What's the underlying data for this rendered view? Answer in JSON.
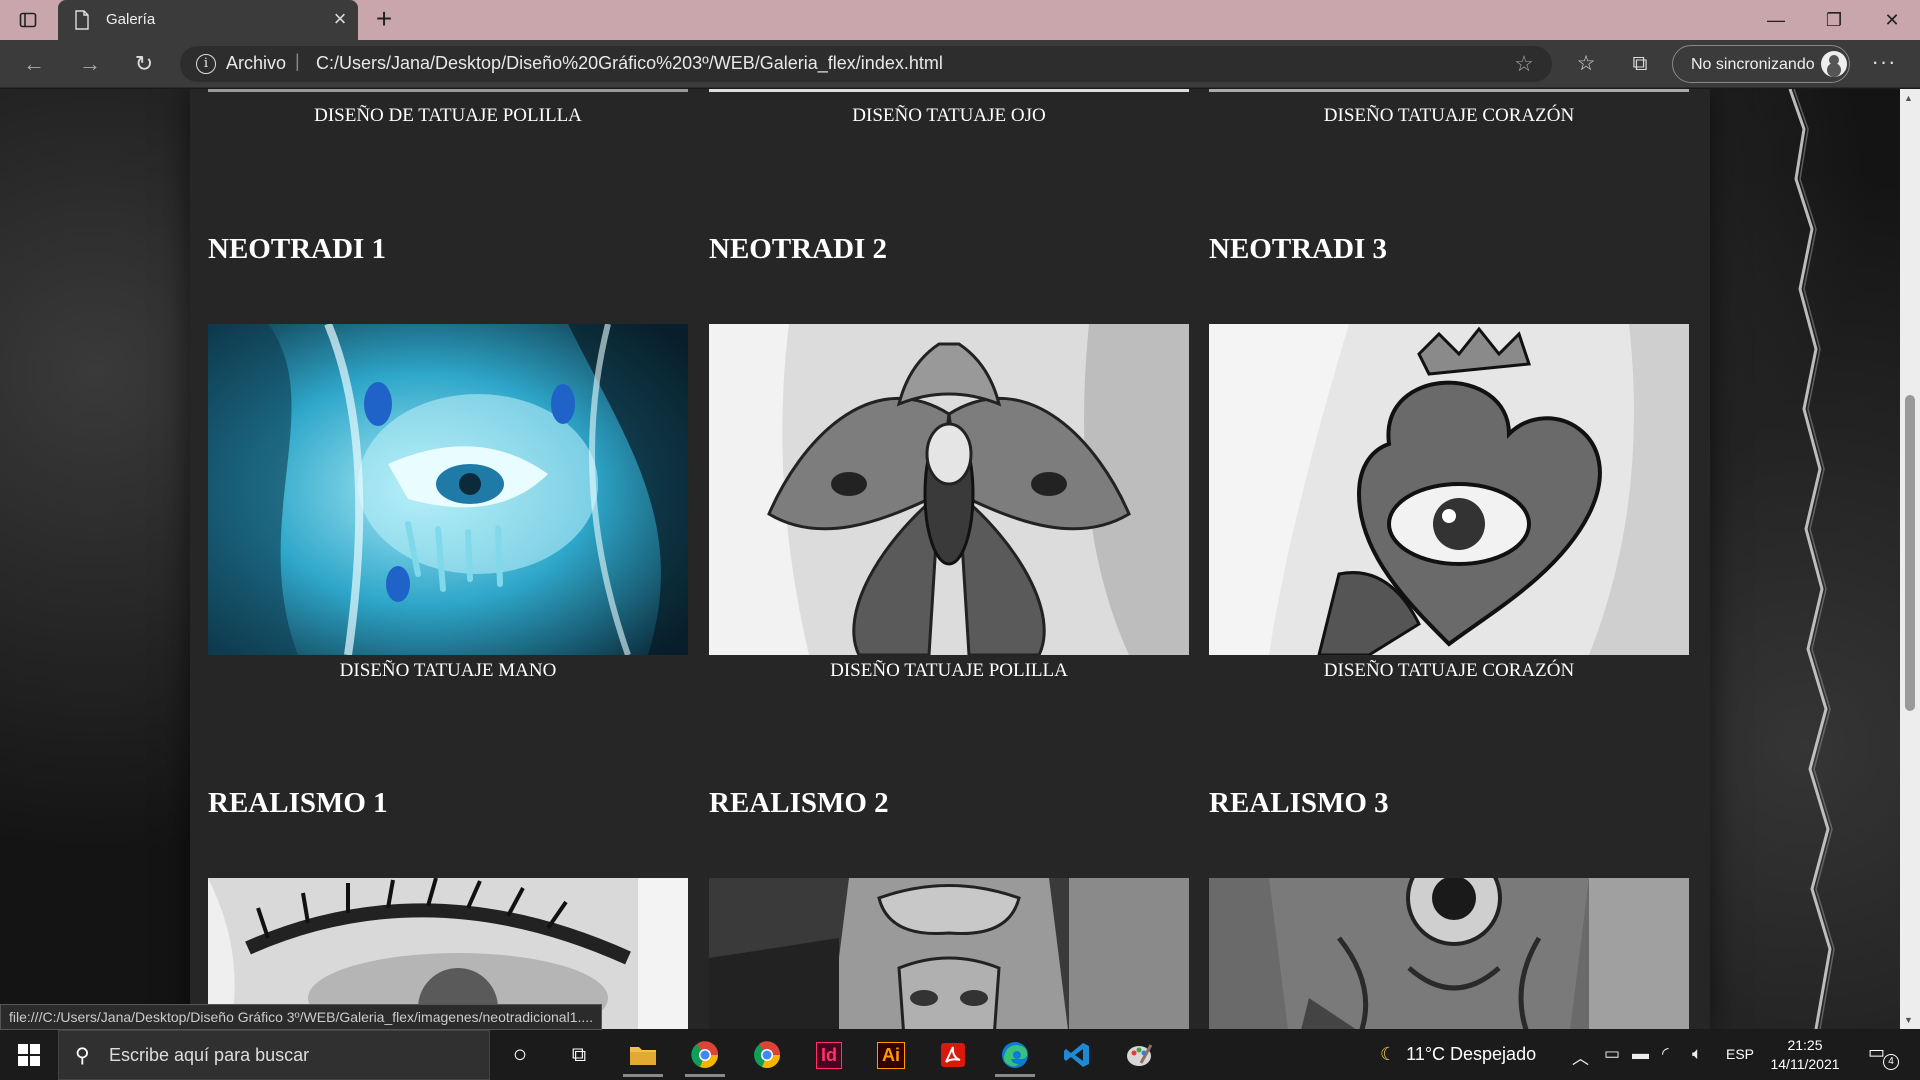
{
  "browser": {
    "tab_title": "Galería",
    "address_scheme": "Archivo",
    "address_url": "C:/Users/Jana/Desktop/Diseño%20Gráfico%203º/WEB/Galeria_flex/index.html",
    "profile_label": "No sincronizando",
    "status_url": "file:///C:/Users/Jana/Desktop/Diseño Gráfico 3º/WEB/Galeria_flex/imagenes/neotradicional1...."
  },
  "gallery": {
    "top_captions": [
      "DISEÑO DE TATUAJE POLILLA",
      "DISEÑO TATUAJE OJO",
      "DISEÑO TATUAJE CORAZÓN"
    ],
    "neotradi": [
      {
        "title": "NEOTRADI 1",
        "caption": "DISEÑO TATUAJE MANO"
      },
      {
        "title": "NEOTRADI 2",
        "caption": "DISEÑO TATUAJE POLILLA"
      },
      {
        "title": "NEOTRADI 3",
        "caption": "DISEÑO TATUAJE CORAZÓN"
      }
    ],
    "realismo": [
      {
        "title": "REALISMO 1"
      },
      {
        "title": "REALISMO 2"
      },
      {
        "title": "REALISMO 3"
      }
    ]
  },
  "taskbar": {
    "search_placeholder": "Escribe aquí para buscar",
    "weather": "11°C  Despejado",
    "language": "ESP",
    "time": "21:25",
    "date": "14/11/2021",
    "notification_count": "4",
    "apps": [
      "task-view",
      "file-explorer",
      "chrome-canary",
      "chrome",
      "indesign",
      "illustrator",
      "acrobat",
      "edge",
      "vscode",
      "paint"
    ]
  }
}
